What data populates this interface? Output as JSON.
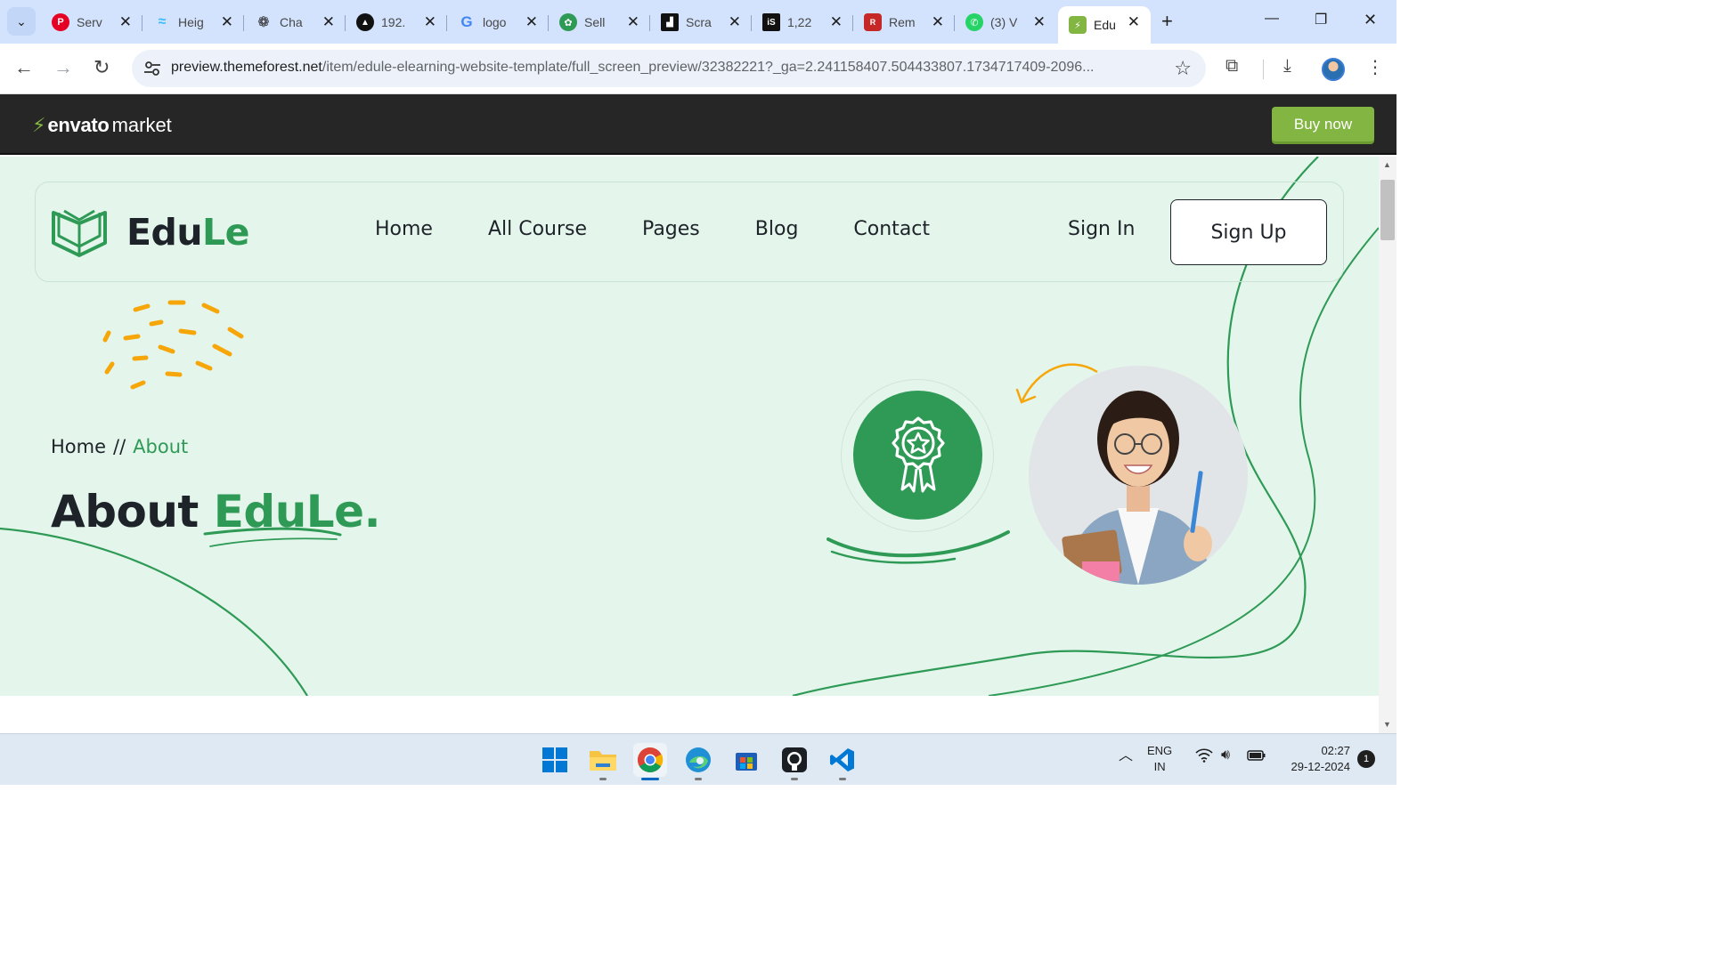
{
  "browser": {
    "tabs": [
      {
        "title": "Serv",
        "favicon": "pinterest-icon",
        "color": "#e60023"
      },
      {
        "title": "Heig",
        "favicon": "tailwind-icon",
        "color": "#38bdf8"
      },
      {
        "title": "Cha",
        "favicon": "chatgpt-icon",
        "color": "#222222"
      },
      {
        "title": "192.",
        "favicon": "triangle-icon",
        "color": "#111111"
      },
      {
        "title": "logo",
        "favicon": "google-icon",
        "color": "#4285f4"
      },
      {
        "title": "Sell",
        "favicon": "sell-icon",
        "color": "#2e9a55"
      },
      {
        "title": "Scra",
        "favicon": "scrape-icon",
        "color": "#111111"
      },
      {
        "title": "1,22",
        "favicon": "is-icon",
        "color": "#111111"
      },
      {
        "title": "Rem",
        "favicon": "remove-icon",
        "color": "#c62828"
      },
      {
        "title": "(3) V",
        "favicon": "whatsapp-icon",
        "color": "#25d366"
      },
      {
        "title": "Edu",
        "favicon": "envato-icon",
        "color": "#82b541"
      }
    ],
    "url_domain": "preview.themeforest.net",
    "url_path": "/item/edule-elearning-website-template/full_screen_preview/32382221?_ga=2.241158407.504433807.1734717409-2096..."
  },
  "envato": {
    "logo_bold": "envato",
    "logo_light": "market",
    "buy_label": "Buy now",
    "accent": "#82b541"
  },
  "site": {
    "logo_text_a": "Edu",
    "logo_text_b": "Le",
    "menu": [
      "Home",
      "All Course",
      "Pages",
      "Blog",
      "Contact"
    ],
    "signin_label": "Sign In",
    "signup_label": "Sign Up",
    "brand_green": "#2e9a55",
    "bg": "#e4f6ec"
  },
  "hero": {
    "breadcrumb_home": "Home",
    "breadcrumb_sep": "//",
    "breadcrumb_current": "About",
    "title_a": "About",
    "title_b": "EduLe."
  },
  "taskbar": {
    "apps": [
      "windows-start-icon",
      "file-explorer-icon",
      "chrome-icon",
      "edge-icon",
      "store-icon",
      "github-icon",
      "vscode-icon"
    ],
    "lang_top": "ENG",
    "lang_bottom": "IN",
    "time": "02:27",
    "date": "29-12-2024",
    "notifications": "1"
  }
}
